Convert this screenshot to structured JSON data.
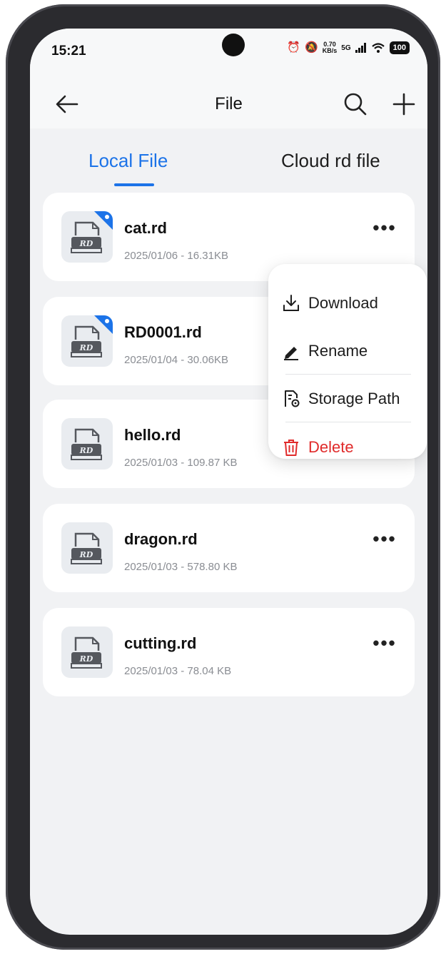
{
  "status_bar": {
    "time": "15:21",
    "network_speed_value": "0.70",
    "network_speed_unit": "KB/s",
    "signal_type": "5G",
    "battery": "100"
  },
  "app_bar": {
    "title": "File",
    "back_icon": "arrow-left-icon",
    "search_icon": "search-icon",
    "add_icon": "plus-icon"
  },
  "tabs": [
    {
      "label": "Local File",
      "active": true
    },
    {
      "label": "Cloud rd file",
      "active": false
    }
  ],
  "files": [
    {
      "name": "cat.rd",
      "meta": "2025/01/06 - 16.31KB",
      "tagged": true
    },
    {
      "name": "RD0001.rd",
      "meta": "2025/01/04 - 30.06KB",
      "tagged": true
    },
    {
      "name": "hello.rd",
      "meta": "2025/01/03 - 109.87 KB",
      "tagged": false
    },
    {
      "name": "dragon.rd",
      "meta": "2025/01/03 - 578.80 KB",
      "tagged": false
    },
    {
      "name": "cutting.rd",
      "meta": "2025/01/03 - 78.04 KB",
      "tagged": false
    }
  ],
  "file_icon_label": "RD",
  "more_label": "•••",
  "context_menu": {
    "items": [
      {
        "label": "Download",
        "icon": "download-icon"
      },
      {
        "label": "Rename",
        "icon": "pencil-icon"
      },
      {
        "label": "Storage Path",
        "icon": "storage-path-icon"
      },
      {
        "label": "Delete",
        "icon": "trash-icon"
      }
    ]
  },
  "colors": {
    "accent": "#1c73e8",
    "danger": "#e02a2a",
    "background": "#f1f2f4"
  }
}
